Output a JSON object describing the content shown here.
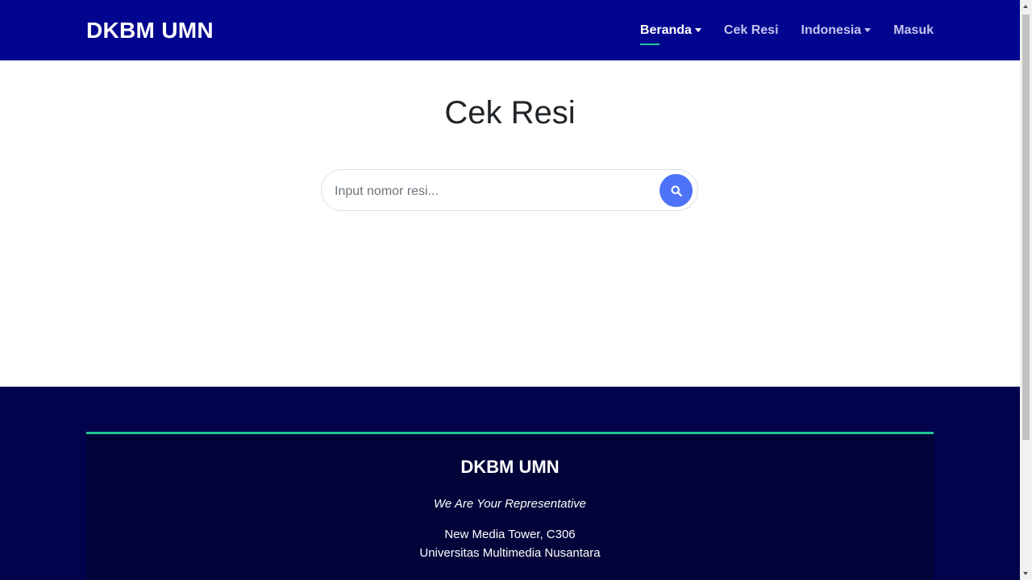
{
  "navbar": {
    "brand": "DKBM UMN",
    "items": [
      {
        "label": "Beranda",
        "dropdown": true,
        "active": true
      },
      {
        "label": "Cek Resi",
        "dropdown": false,
        "active": false
      },
      {
        "label": "Indonesia",
        "dropdown": true,
        "active": false
      },
      {
        "label": "Masuk",
        "dropdown": false,
        "active": false
      }
    ]
  },
  "main": {
    "title": "Cek Resi",
    "search": {
      "placeholder": "Input nomor resi...",
      "value": "",
      "button_icon": "search-icon"
    }
  },
  "footer": {
    "brand": "DKBM UMN",
    "tagline": "We Are Your Representative",
    "address_line1": "New Media Tower, C306",
    "address_line2": "Universitas Multimedia Nusantara"
  },
  "colors": {
    "navbar_bg": "#02058e",
    "accent_green": "#22c493",
    "search_button": "#4e73f8",
    "footer_bg": "#02034d",
    "footer_inner_bg": "#020339"
  }
}
